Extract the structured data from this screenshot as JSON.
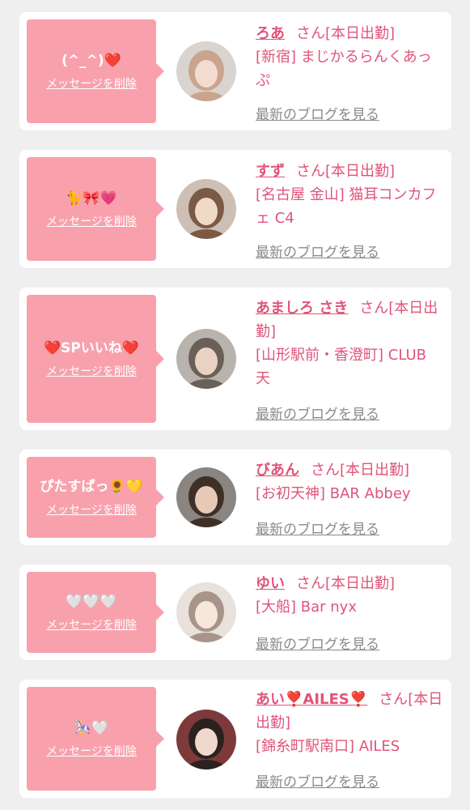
{
  "delete_label": "メッセージを削除",
  "blog_label": "最新のブログを見る",
  "colors": {
    "bubble": "#f8a1ad",
    "accent": "#e0547a",
    "muted": "#8a8a8a",
    "card": "#ffffff",
    "background": "#efefef"
  },
  "cards": [
    {
      "message": "(^_^)❤️",
      "name": "ろあ",
      "honorific": "さん",
      "status": "[本日出勤]",
      "location": "[新宿] まじかるらんくあっぷ",
      "avatar_icon": "avatar-photo"
    },
    {
      "message": "🐈🎀💗",
      "name": "すず",
      "honorific": "さん",
      "status": "[本日出勤]",
      "location": "[名古屋 金山] 猫耳コンカフェ C4",
      "avatar_icon": "avatar-photo"
    },
    {
      "message": "❤️SPいいね❤️",
      "name": "あましろ さき",
      "honorific": "さん",
      "status": "[本日出勤]",
      "location": "[山形駅前・香澄町] CLUB 天",
      "avatar_icon": "avatar-photo"
    },
    {
      "message": "ぴたすぱっ🌻💛",
      "name": "びあん",
      "honorific": "さん",
      "status": "[本日出勤]",
      "location": "[お初天神] BAR Abbey",
      "avatar_icon": "avatar-photo"
    },
    {
      "message": "🤍🤍🤍",
      "name": "ゆい",
      "honorific": "さん",
      "status": "[本日出勤]",
      "location": "[大船] Bar nyx",
      "avatar_icon": "avatar-photo"
    },
    {
      "message": "🎠🤍",
      "name": "あい❣️AILES❣️",
      "honorific": "さん",
      "status": "[本日出勤]",
      "location": "[錦糸町駅南口] AILES",
      "avatar_icon": "avatar-photo"
    }
  ]
}
